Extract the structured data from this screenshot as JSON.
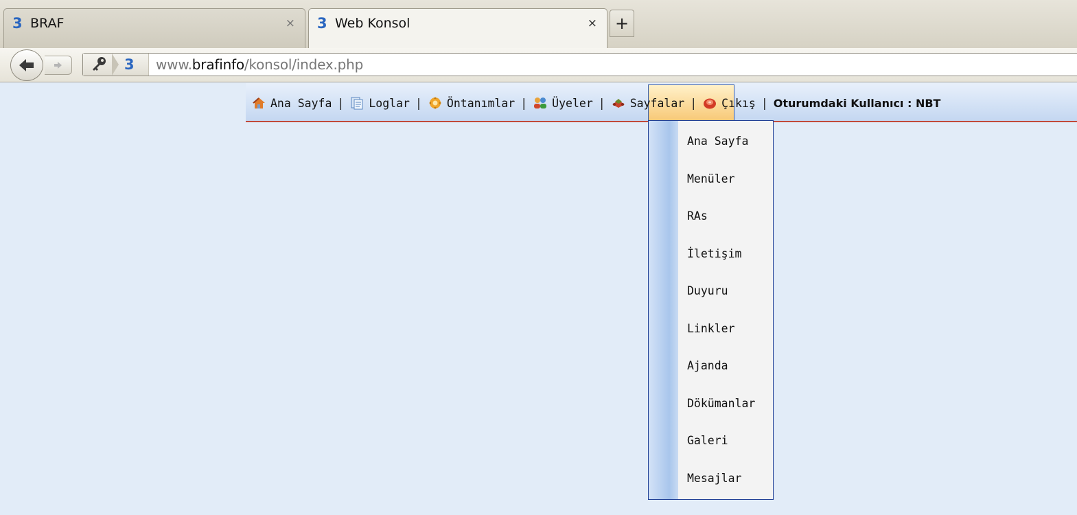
{
  "browser": {
    "tabs": [
      {
        "title": "BRAF",
        "active": false
      },
      {
        "title": "Web Konsol",
        "active": true
      }
    ],
    "tab_close_glyph": "×",
    "new_tab_glyph": "+",
    "site_glyph": "3",
    "url": {
      "prefix": "www.",
      "host": "brafinfo",
      "path": "/konsol/index.php"
    }
  },
  "menu": {
    "items": [
      {
        "label": "Ana Sayfa",
        "icon": "home-icon"
      },
      {
        "label": "Loglar",
        "icon": "logs-icon"
      },
      {
        "label": "Öntanımlar",
        "icon": "settings-icon"
      },
      {
        "label": "Üyeler",
        "icon": "users-icon"
      },
      {
        "label": "Sayfalar",
        "icon": "pages-icon"
      },
      {
        "label": "Çıkış",
        "icon": "logout-icon"
      }
    ],
    "separator": "|",
    "user_label": "Oturumdaki Kullanıcı : NBT",
    "selected": "Sayfalar"
  },
  "dropdown": {
    "items": [
      "Ana Sayfa",
      "Menüler",
      "RAs",
      "İletişim",
      "Duyuru",
      "Linkler",
      "Ajanda",
      "Dökümanlar",
      "Galeri",
      "Mesajlar"
    ]
  },
  "colors": {
    "page_bg": "#e2ecf8",
    "menu_underline": "#c24a3a",
    "selected_bg": "#f8c978",
    "dropdown_border": "#1f3f95"
  }
}
